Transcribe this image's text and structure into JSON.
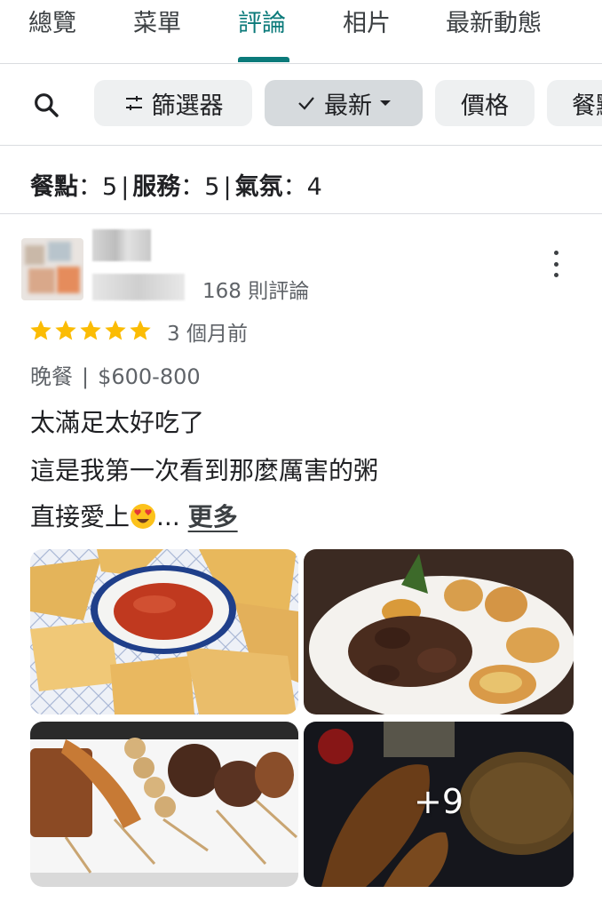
{
  "tabs": [
    {
      "label": "總覽"
    },
    {
      "label": "菜單"
    },
    {
      "label": "評論",
      "active": true
    },
    {
      "label": "相片"
    },
    {
      "label": "最新動態"
    }
  ],
  "filters": {
    "search_icon": "search-icon",
    "chips": [
      {
        "label": "篩選器",
        "icon": "tune-icon"
      },
      {
        "label": "最新",
        "icon": "check-icon",
        "selected": true,
        "dropdown": true
      },
      {
        "label": "價格"
      },
      {
        "label": "餐點"
      }
    ]
  },
  "summary": {
    "food_label": "餐點",
    "food_value": "5",
    "service_label": "服務",
    "service_value": "5",
    "atmosphere_label": "氣氛",
    "atmosphere_value": "4"
  },
  "review": {
    "review_count": "168 則評論",
    "rating": 5,
    "time_ago": "3 個月前",
    "meal_type": "晚餐",
    "price_range": "$600-800",
    "lines": [
      "太滿足太好吃了",
      "這是我第一次看到那麼厲害的粥",
      "直接愛上"
    ],
    "ellipsis": "...",
    "more_label": "更多",
    "photos_more": "+9"
  },
  "colors": {
    "accent": "#0b7a7a",
    "star": "#fbbc04",
    "chip_bg": "#eef0f1",
    "chip_selected_bg": "#d6dadd"
  }
}
